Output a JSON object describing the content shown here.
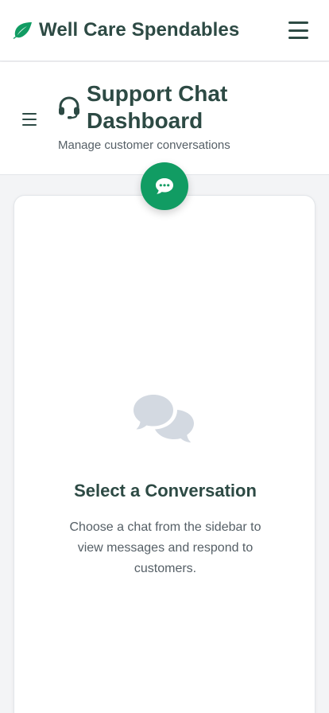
{
  "app": {
    "brand_name": "Well Care Spendables",
    "brand_icon": "leaf-icon",
    "brand_color": "#119c63",
    "menu_icon": "hamburger-menu-icon"
  },
  "page_header": {
    "title": "Support Chat Dashboard",
    "subtitle": "Manage customer conversations",
    "title_icon": "headset-icon",
    "sidebar_toggle_icon": "hamburger-menu-icon"
  },
  "chat_fab": {
    "icon": "chat-bubble-icon",
    "color": "#119c63"
  },
  "empty_state": {
    "icon": "conversation-bubbles-icon",
    "title": "Select a Conversation",
    "description": "Choose a chat from the sidebar to view messages and respond to customers."
  }
}
